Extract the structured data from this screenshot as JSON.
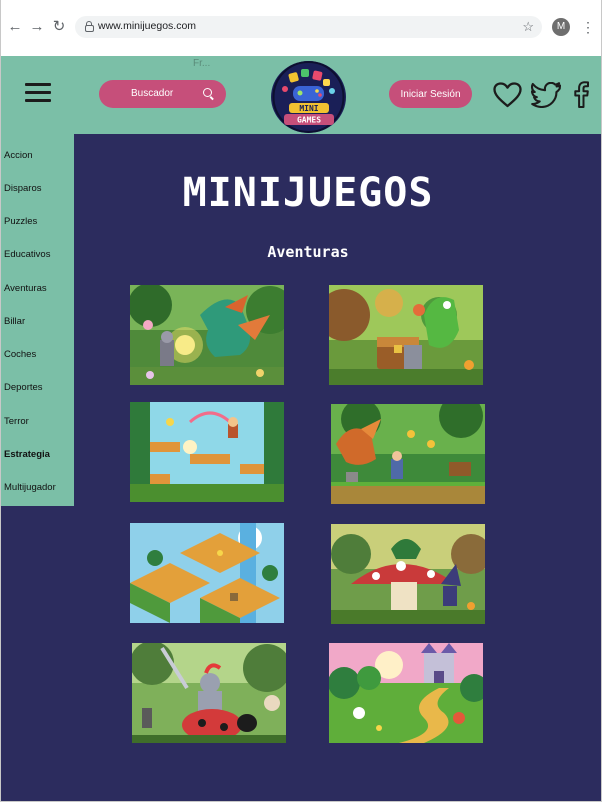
{
  "browser": {
    "url": "www.minijuegos.com",
    "avatar_letter": "M"
  },
  "header": {
    "search_label": "Buscador",
    "login_label": "Iniciar Sesión",
    "fragment_text": "Fr...",
    "logo_text": "MINI GAMES"
  },
  "sidebar": {
    "items": [
      {
        "label": "Accion"
      },
      {
        "label": "Disparos"
      },
      {
        "label": "Puzzles"
      },
      {
        "label": "Educativos"
      },
      {
        "label": "Aventuras"
      },
      {
        "label": "Billar"
      },
      {
        "label": "Coches"
      },
      {
        "label": "Deportes"
      },
      {
        "label": "Terror"
      },
      {
        "label": "Estrategia"
      },
      {
        "label": "Multijugador"
      }
    ],
    "active": "Estrategia"
  },
  "main": {
    "title": "MINIJUEGOS",
    "category_title": "Aventuras",
    "games": [
      {
        "name": "dragon-knight-forest"
      },
      {
        "name": "dragon-treasure-chest"
      },
      {
        "name": "platform-forest-level"
      },
      {
        "name": "dragon-castle-level"
      },
      {
        "name": "isometric-island"
      },
      {
        "name": "mushroom-dragon-wizard"
      },
      {
        "name": "knight-ladybug"
      },
      {
        "name": "castle-forest-path"
      }
    ]
  },
  "colors": {
    "header_bg": "#7bbfa7",
    "page_bg": "#2c2c5e",
    "pill_bg": "#c64f7a"
  }
}
